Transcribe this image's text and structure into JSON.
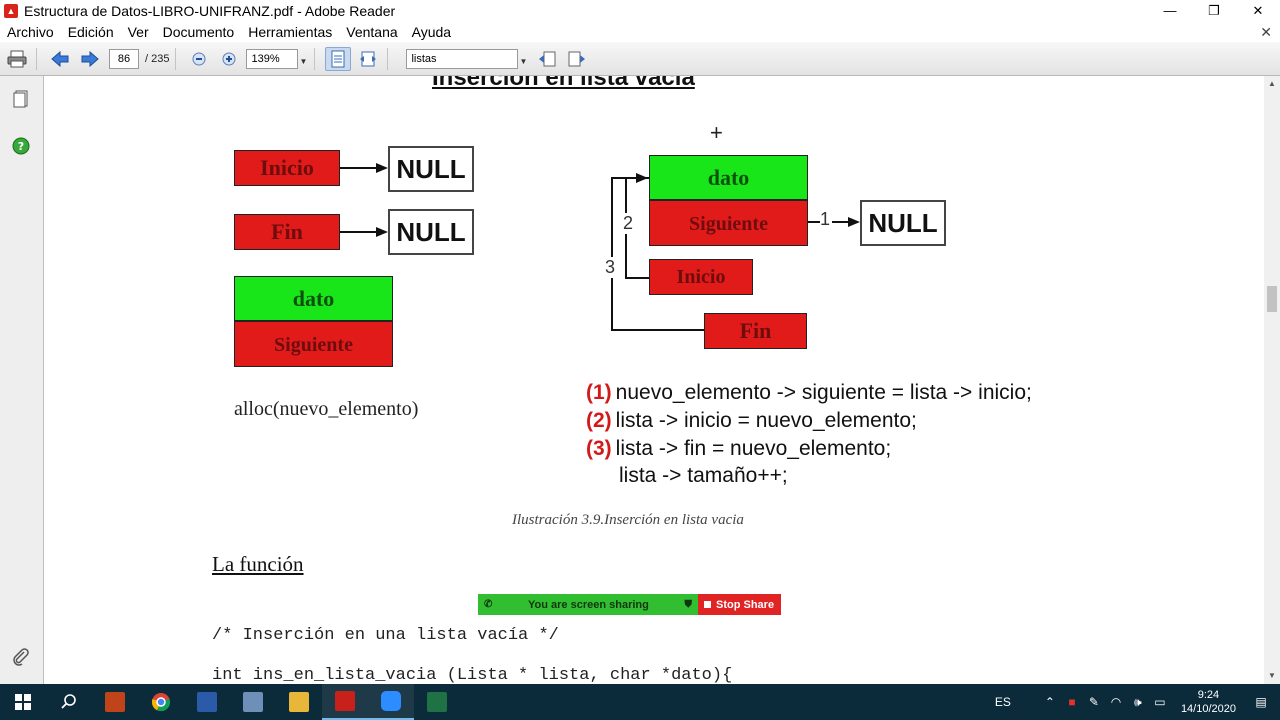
{
  "window": {
    "title": "Estructura de Datos-LIBRO-UNIFRANZ.pdf - Adobe Reader",
    "minimize": "—",
    "restore": "❐",
    "close": "✕"
  },
  "menu": {
    "items": [
      "Archivo",
      "Edición",
      "Ver",
      "Documento",
      "Herramientas",
      "Ventana",
      "Ayuda"
    ],
    "close": "✕"
  },
  "toolbar": {
    "page_current": "86",
    "page_total": "/ 235",
    "zoom": "139%",
    "search_value": "listas"
  },
  "document": {
    "heading": "Inserción en lista vacía",
    "left_diagram": {
      "inicio": "Inicio",
      "fin": "Fin",
      "null1": "NULL",
      "null2": "NULL",
      "dato": "dato",
      "siguiente": "Siguiente",
      "alloc": "alloc(nuevo_elemento)"
    },
    "right_diagram": {
      "plus": "+",
      "dato": "dato",
      "siguiente": "Siguiente",
      "null": "NULL",
      "inicio": "Inicio",
      "fin": "Fin",
      "n1": "1",
      "n2": "2",
      "n3": "3"
    },
    "code": [
      {
        "num": "(1)",
        "text": "nuevo_elemento -> siguiente = lista -> inicio;"
      },
      {
        "num": "(2)",
        "text": "lista -> inicio = nuevo_elemento;"
      },
      {
        "num": "(3)",
        "text": "lista -> fin = nuevo_elemento;"
      },
      {
        "num": "",
        "text": "lista -> tamaño++;"
      }
    ],
    "caption": "Ilustración 3.9.Inserción en lista vacia",
    "section_title": "La función",
    "code_comment": "/* Inserción en una lista vacía */",
    "code_signature": "int ins_en_lista_vacia (Lista * lista, char *dato){"
  },
  "share_banner": {
    "text": "You are screen sharing",
    "stop": "Stop Share"
  },
  "taskbar": {
    "language": "ES",
    "time": "9:24",
    "date": "14/10/2020"
  }
}
